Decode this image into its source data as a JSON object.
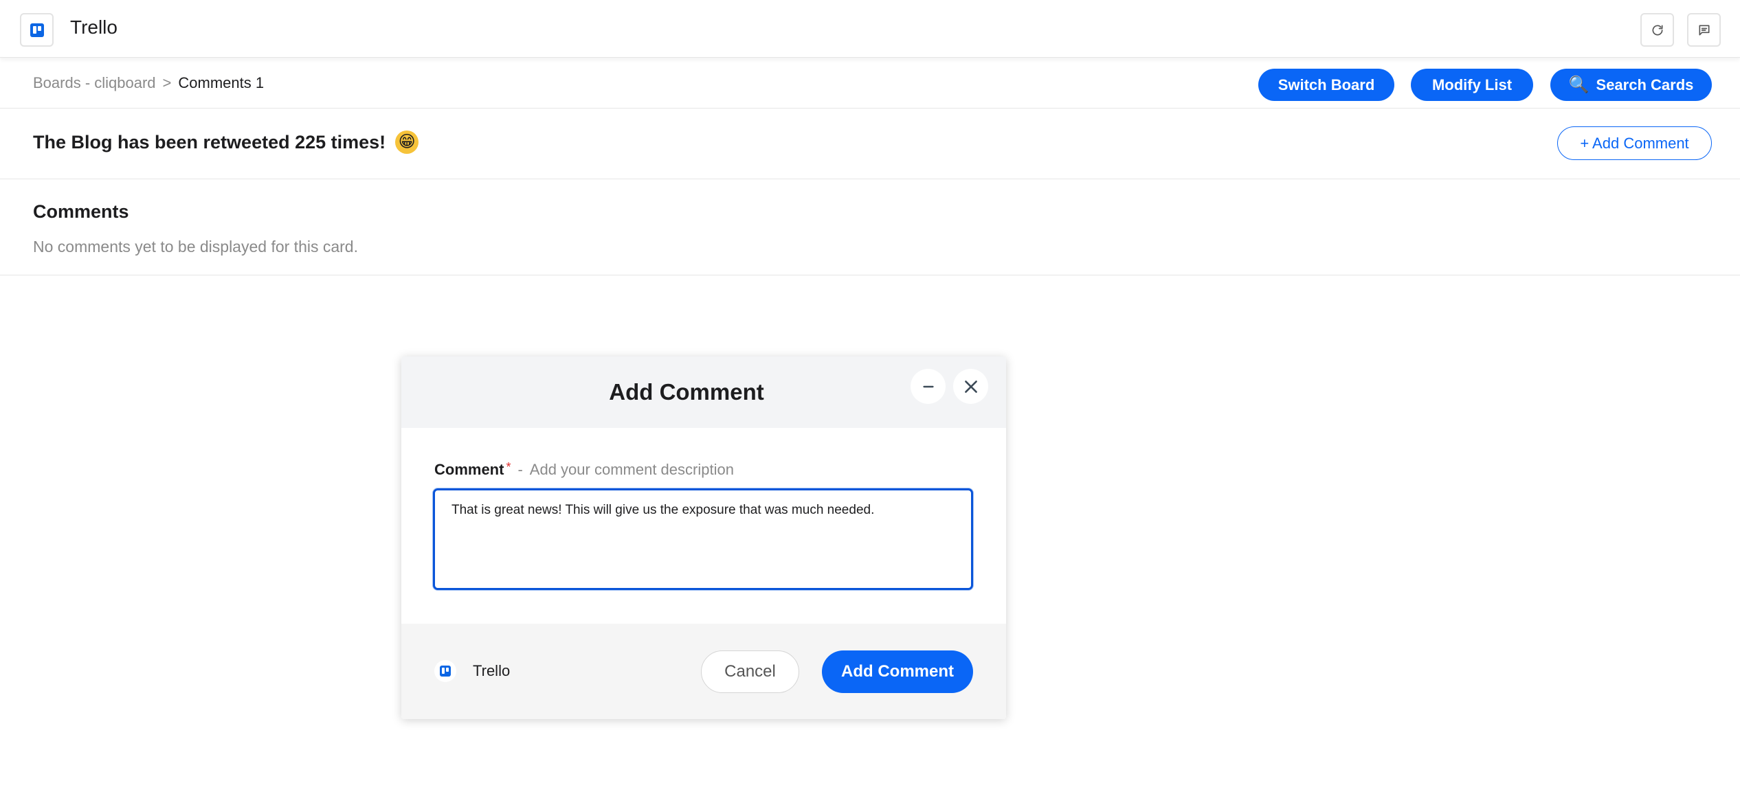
{
  "app": {
    "title": "Trello",
    "logo_icon": "trello-logo-icon",
    "brand_color": "#0c66e4"
  },
  "topbar": {
    "refresh_icon": "refresh-icon",
    "chat_icon": "message-square-icon"
  },
  "breadcrumb": {
    "parent": "Boards - cliqboard",
    "separator": ">",
    "current": "Comments 1"
  },
  "actions": {
    "switch_board": "Switch Board",
    "modify_list": "Modify List",
    "search_cards": "Search Cards",
    "search_cards_emoji": "🔍",
    "accent": "#0a66f6"
  },
  "card": {
    "title": "The Blog has been retweeted 225 times!",
    "emoji": "😁",
    "add_comment": "+ Add Comment"
  },
  "comments": {
    "heading": "Comments",
    "empty_text": "No comments yet to be displayed for this card."
  },
  "modal": {
    "title": "Add Comment",
    "minimize_icon": "minus-icon",
    "close_icon": "close-icon",
    "field_label": "Comment",
    "required_mark": "*",
    "dash": "-",
    "field_hint": "Add your comment description",
    "comment_value": "That is great news! This will give us the exposure that was much needed.",
    "footer_brand": "Trello",
    "cancel": "Cancel",
    "submit": "Add Comment"
  }
}
